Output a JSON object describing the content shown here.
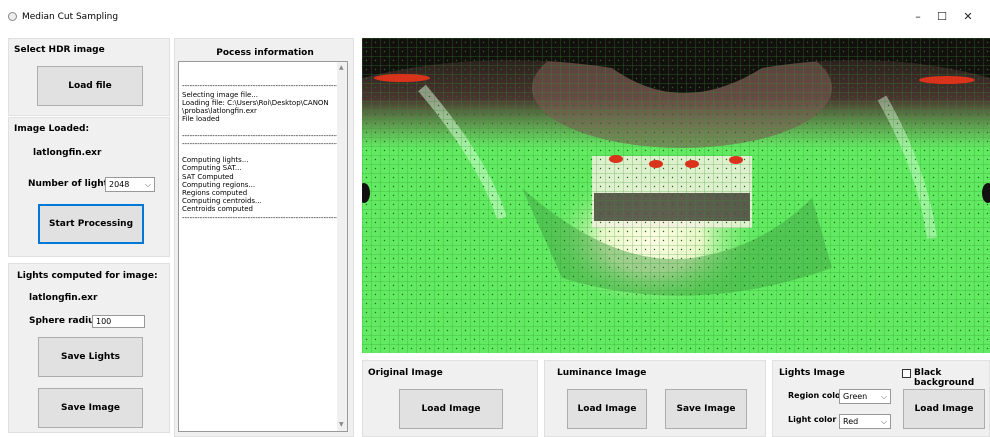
{
  "window": {
    "title": "Median Cut Sampling",
    "minimize": "–",
    "maximize": "☐",
    "close": "✕"
  },
  "select_panel": {
    "heading": "Select HDR image",
    "load_file": "Load file"
  },
  "loaded_panel": {
    "heading": "Image Loaded:",
    "filename": "latlongfin.exr",
    "num_lights_label": "Number of lights:",
    "num_lights_value": "2048",
    "start": "Start Processing"
  },
  "lights_panel": {
    "heading": "Lights computed for image:",
    "filename": "latlongfin.exr",
    "sphere_label": "Sphere radius",
    "sphere_value": "100",
    "save_lights": "Save Lights",
    "save_image": "Save Image"
  },
  "process_panel": {
    "heading": "Pocess information",
    "log": "--------------------------------------------------------------------\nSelecting image file...\nLoading file: C:\\Users\\Roi\\Desktop\\CANON\n\\probas\\latlongfin.exr\nFile loaded\n\n--------------------------------------------------------------------\n--------------------------------------------------------------------\n\nComputing lights...\nComputing SAT...\nSAT Computed\nComputing regions...\nRegions computed\nComputing centroids...\nCentroids computed\n--------------------------------------------------------------------"
  },
  "original_panel": {
    "heading": "Original Image",
    "load": "Load Image"
  },
  "luminance_panel": {
    "heading": "Luminance Image",
    "load": "Load Image",
    "save": "Save Image"
  },
  "lights_image_panel": {
    "heading": "Lights Image",
    "black_bg": "Black background",
    "region_label": "Region color",
    "region_value": "Green",
    "light_label": "Light color",
    "light_value": "Red",
    "load": "Load Image"
  },
  "colors": {
    "accent": "#0078d7",
    "region": "#3cff3c",
    "light": "#e53a1e"
  }
}
